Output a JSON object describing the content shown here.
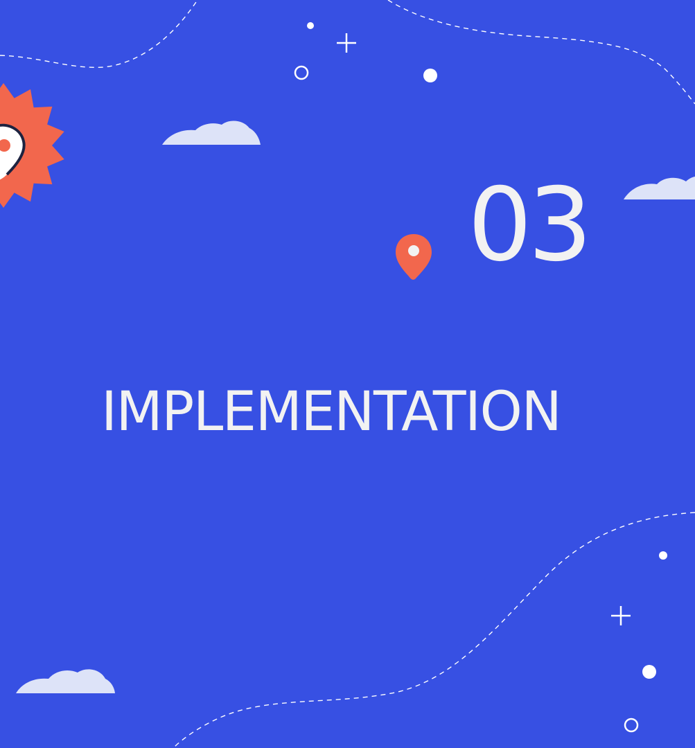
{
  "slide": {
    "number": "03",
    "title": "IMPLEMENTATION"
  },
  "colors": {
    "background": "#3750E3",
    "text": "#F2F2F2",
    "accent": "#F2674D",
    "cloud": "#DDE3F8",
    "decoration": "#FFFFFF"
  },
  "icons": {
    "map_pin": "map-pin-icon",
    "sun_badge": "sun-badge-icon"
  }
}
